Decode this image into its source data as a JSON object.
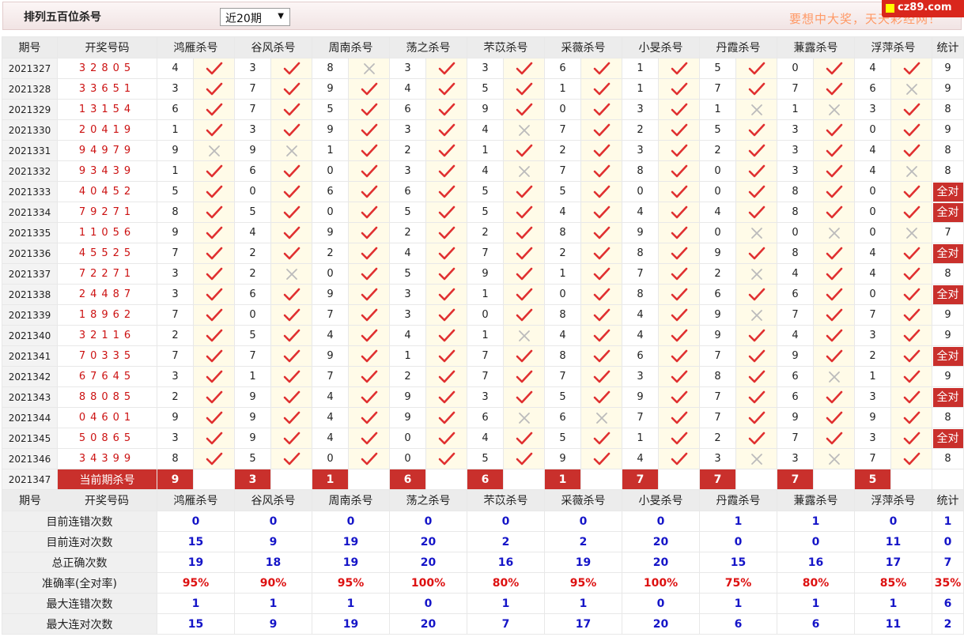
{
  "header": {
    "title": "排列五百位杀号",
    "period_select": "近20期",
    "slogan": "要想中大奖，天天彩经网！",
    "brand": "cz89.com"
  },
  "columns": {
    "period": "期号",
    "draw": "开奖号码",
    "experts": [
      "鸿雁杀号",
      "谷风杀号",
      "周南杀号",
      "荡之杀号",
      "芣苡杀号",
      "采薇杀号",
      "小旻杀号",
      "丹霞杀号",
      "蒹露杀号",
      "浮萍杀号"
    ],
    "stat": "统计"
  },
  "rows": [
    {
      "period": "2021327",
      "draw": "32805",
      "kills": [
        4,
        3,
        8,
        3,
        3,
        6,
        1,
        5,
        0,
        4
      ],
      "marks": [
        1,
        1,
        0,
        1,
        1,
        1,
        1,
        1,
        1,
        1
      ],
      "stat": "9"
    },
    {
      "period": "2021328",
      "draw": "33651",
      "kills": [
        3,
        7,
        9,
        4,
        5,
        1,
        1,
        7,
        7,
        6
      ],
      "marks": [
        1,
        1,
        1,
        1,
        1,
        1,
        1,
        1,
        1,
        0
      ],
      "stat": "9"
    },
    {
      "period": "2021329",
      "draw": "13154",
      "kills": [
        6,
        7,
        5,
        6,
        9,
        0,
        3,
        1,
        1,
        3
      ],
      "marks": [
        1,
        1,
        1,
        1,
        1,
        1,
        1,
        0,
        0,
        1
      ],
      "stat": "8"
    },
    {
      "period": "2021330",
      "draw": "20419",
      "kills": [
        1,
        3,
        9,
        3,
        4,
        7,
        2,
        5,
        3,
        0
      ],
      "marks": [
        1,
        1,
        1,
        1,
        0,
        1,
        1,
        1,
        1,
        1
      ],
      "stat": "9"
    },
    {
      "period": "2021331",
      "draw": "94979",
      "kills": [
        9,
        9,
        1,
        2,
        1,
        2,
        3,
        2,
        3,
        4
      ],
      "marks": [
        0,
        0,
        1,
        1,
        1,
        1,
        1,
        1,
        1,
        1
      ],
      "stat": "8"
    },
    {
      "period": "2021332",
      "draw": "93439",
      "kills": [
        1,
        6,
        0,
        3,
        4,
        7,
        8,
        0,
        3,
        4
      ],
      "marks": [
        1,
        1,
        1,
        1,
        0,
        1,
        1,
        1,
        1,
        0
      ],
      "stat": "8"
    },
    {
      "period": "2021333",
      "draw": "40452",
      "kills": [
        5,
        0,
        6,
        6,
        5,
        5,
        0,
        0,
        8,
        0
      ],
      "marks": [
        1,
        1,
        1,
        1,
        1,
        1,
        1,
        1,
        1,
        1
      ],
      "stat": "全对"
    },
    {
      "period": "2021334",
      "draw": "79271",
      "kills": [
        8,
        5,
        0,
        5,
        5,
        4,
        4,
        4,
        8,
        0
      ],
      "marks": [
        1,
        1,
        1,
        1,
        1,
        1,
        1,
        1,
        1,
        1
      ],
      "stat": "全对"
    },
    {
      "period": "2021335",
      "draw": "11056",
      "kills": [
        9,
        4,
        9,
        2,
        2,
        8,
        9,
        0,
        0,
        0
      ],
      "marks": [
        1,
        1,
        1,
        1,
        1,
        1,
        1,
        0,
        0,
        0
      ],
      "stat": "7"
    },
    {
      "period": "2021336",
      "draw": "45525",
      "kills": [
        7,
        2,
        2,
        4,
        7,
        2,
        8,
        9,
        8,
        4
      ],
      "marks": [
        1,
        1,
        1,
        1,
        1,
        1,
        1,
        1,
        1,
        1
      ],
      "stat": "全对"
    },
    {
      "period": "2021337",
      "draw": "72271",
      "kills": [
        3,
        2,
        0,
        5,
        9,
        1,
        7,
        2,
        4,
        4
      ],
      "marks": [
        1,
        0,
        1,
        1,
        1,
        1,
        1,
        0,
        1,
        1
      ],
      "stat": "8"
    },
    {
      "period": "2021338",
      "draw": "24487",
      "kills": [
        3,
        6,
        9,
        3,
        1,
        0,
        8,
        6,
        6,
        0
      ],
      "marks": [
        1,
        1,
        1,
        1,
        1,
        1,
        1,
        1,
        1,
        1
      ],
      "stat": "全对"
    },
    {
      "period": "2021339",
      "draw": "18962",
      "kills": [
        7,
        0,
        7,
        3,
        0,
        8,
        4,
        9,
        7,
        7
      ],
      "marks": [
        1,
        1,
        1,
        1,
        1,
        1,
        1,
        0,
        1,
        1
      ],
      "stat": "9"
    },
    {
      "period": "2021340",
      "draw": "32116",
      "kills": [
        2,
        5,
        4,
        4,
        1,
        4,
        4,
        9,
        4,
        3
      ],
      "marks": [
        1,
        1,
        1,
        1,
        0,
        1,
        1,
        1,
        1,
        1
      ],
      "stat": "9"
    },
    {
      "period": "2021341",
      "draw": "70335",
      "kills": [
        7,
        7,
        9,
        1,
        7,
        8,
        6,
        7,
        9,
        2
      ],
      "marks": [
        1,
        1,
        1,
        1,
        1,
        1,
        1,
        1,
        1,
        1
      ],
      "stat": "全对"
    },
    {
      "period": "2021342",
      "draw": "67645",
      "kills": [
        3,
        1,
        7,
        2,
        7,
        7,
        3,
        8,
        6,
        1
      ],
      "marks": [
        1,
        1,
        1,
        1,
        1,
        1,
        1,
        1,
        0,
        1
      ],
      "stat": "9"
    },
    {
      "period": "2021343",
      "draw": "88085",
      "kills": [
        2,
        9,
        4,
        9,
        3,
        5,
        9,
        7,
        6,
        3
      ],
      "marks": [
        1,
        1,
        1,
        1,
        1,
        1,
        1,
        1,
        1,
        1
      ],
      "stat": "全对"
    },
    {
      "period": "2021344",
      "draw": "04601",
      "kills": [
        9,
        9,
        4,
        9,
        6,
        6,
        7,
        7,
        9,
        9
      ],
      "marks": [
        1,
        1,
        1,
        1,
        0,
        0,
        1,
        1,
        1,
        1
      ],
      "stat": "8"
    },
    {
      "period": "2021345",
      "draw": "50865",
      "kills": [
        3,
        9,
        4,
        0,
        4,
        5,
        1,
        2,
        7,
        3
      ],
      "marks": [
        1,
        1,
        1,
        1,
        1,
        1,
        1,
        1,
        1,
        1
      ],
      "stat": "全对"
    },
    {
      "period": "2021346",
      "draw": "34399",
      "kills": [
        8,
        5,
        0,
        0,
        5,
        9,
        4,
        3,
        3,
        7
      ],
      "marks": [
        1,
        1,
        1,
        1,
        1,
        1,
        1,
        0,
        0,
        1
      ],
      "stat": "8"
    }
  ],
  "current": {
    "period": "2021347",
    "label": "当前期杀号",
    "kills": [
      9,
      3,
      1,
      6,
      6,
      1,
      7,
      7,
      7,
      5
    ]
  },
  "stats": [
    {
      "label": "目前连错次数",
      "values": [
        "0",
        "0",
        "0",
        "0",
        "0",
        "0",
        "0",
        "1",
        "1",
        "0",
        "1"
      ]
    },
    {
      "label": "目前连对次数",
      "values": [
        "15",
        "9",
        "19",
        "20",
        "2",
        "2",
        "20",
        "0",
        "0",
        "11",
        "0"
      ]
    },
    {
      "label": "总正确次数",
      "values": [
        "19",
        "18",
        "19",
        "20",
        "16",
        "19",
        "20",
        "15",
        "16",
        "17",
        "7"
      ]
    },
    {
      "label": "准确率(全对率)",
      "values": [
        "95%",
        "90%",
        "95%",
        "100%",
        "80%",
        "95%",
        "100%",
        "75%",
        "80%",
        "85%",
        "35%"
      ]
    },
    {
      "label": "最大连错次数",
      "values": [
        "1",
        "1",
        "1",
        "0",
        "1",
        "1",
        "0",
        "1",
        "1",
        "1",
        "6"
      ]
    },
    {
      "label": "最大连对次数",
      "values": [
        "15",
        "9",
        "19",
        "20",
        "7",
        "17",
        "20",
        "6",
        "6",
        "11",
        "2"
      ]
    }
  ],
  "colors": {
    "accent_red": "#c9302c",
    "check_red": "#e03030",
    "cross_gray": "#bbbbbb",
    "stat_blue": "#1515c8"
  },
  "icons": {
    "correct": "check-icon",
    "wrong": "cross-icon"
  }
}
